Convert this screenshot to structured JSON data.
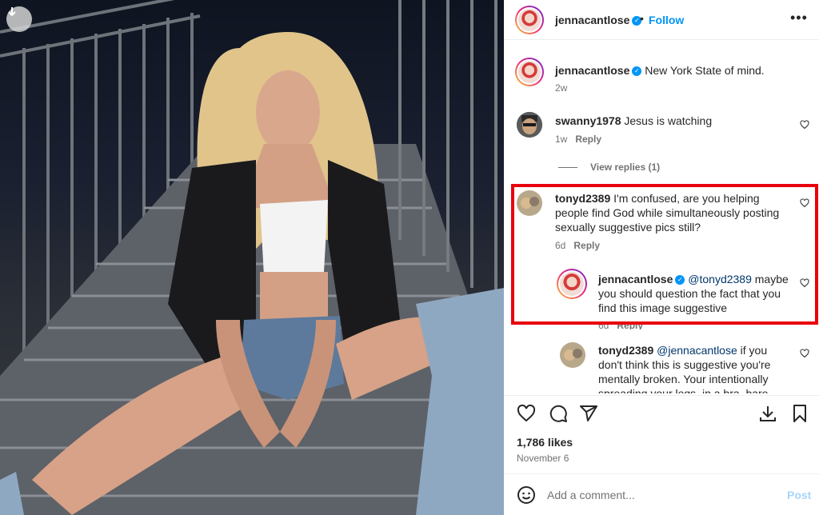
{
  "header": {
    "username": "jennacantlose",
    "separator": "•",
    "follow_label": "Follow",
    "more_label": "•••"
  },
  "caption": {
    "username": "jennacantlose",
    "text": "New York State of mind.",
    "time": "2w"
  },
  "comments": [
    {
      "username": "swanny1978",
      "text": "Jesus is watching",
      "time": "1w",
      "reply_label": "Reply",
      "view_replies": "View replies (1)"
    },
    {
      "username": "tonyd2389",
      "text": "I'm confused, are you helping people find God while simultaneously posting sexually suggestive pics still?",
      "time": "6d",
      "reply_label": "Reply",
      "replies": [
        {
          "username": "jennacantlose",
          "mention": "@tonyd2389",
          "text": "maybe you should question the fact that you find this image suggestive",
          "time": "6d",
          "reply_label": "Reply"
        },
        {
          "username": "tonyd2389",
          "mention": "@jennacantlose",
          "text": "if you don't think this is suggestive you're mentally broken. Your intentionally spreading your legs, in a bra, bare..."
        }
      ]
    }
  ],
  "actions": {
    "icons": [
      "heart-icon",
      "comment-icon",
      "share-icon",
      "download-icon",
      "bookmark-icon"
    ]
  },
  "likes": "1,786 likes",
  "date": "November 6",
  "add_comment": {
    "placeholder": "Add a comment...",
    "post_label": "Post"
  },
  "colors": {
    "accent": "#0095f6",
    "highlight": "#e8000d",
    "post_disabled": "#a8d4fb",
    "muted": "#737373"
  }
}
